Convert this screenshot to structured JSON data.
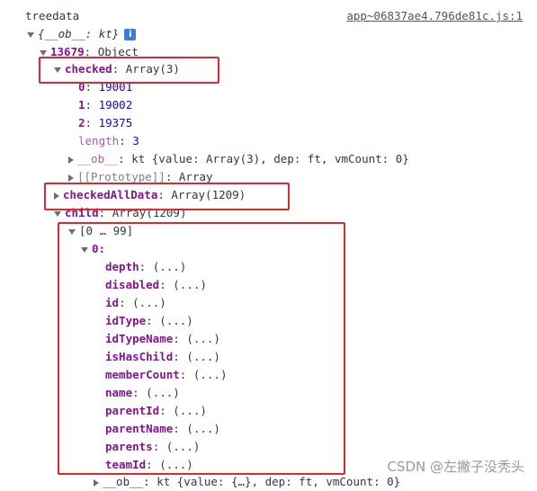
{
  "root_label": "treedata",
  "source_link": "app~06837ae4.796de81c.js:1",
  "root_obj": "{__ob__: kt}",
  "obj_key": "13679",
  "obj_val": ": Object",
  "checked": {
    "key": "checked",
    "val": ": Array(3)"
  },
  "checked_items": [
    {
      "idx": "0",
      "val": "19001"
    },
    {
      "idx": "1",
      "val": "19002"
    },
    {
      "idx": "2",
      "val": "19375"
    }
  ],
  "length_key": "length",
  "length_val": "3",
  "ob_key": "__ob__",
  "ob_val": ": kt {value: Array(3), dep: ft, vmCount: 0}",
  "proto_key": "[[Prototype]]",
  "proto_val": ": Array",
  "checked_all": {
    "key": "checkedAllData",
    "val": ": Array(1209)"
  },
  "child": {
    "key": "child",
    "val": ": Array(1209)"
  },
  "range_label": "[0 … 99]",
  "item0_key": "0:",
  "fields": [
    {
      "key": "depth",
      "val": ": (...)"
    },
    {
      "key": "disabled",
      "val": ": (...)"
    },
    {
      "key": "id",
      "val": ": (...)"
    },
    {
      "key": "idType",
      "val": ": (...)"
    },
    {
      "key": "idTypeName",
      "val": ": (...)"
    },
    {
      "key": "isHasChild",
      "val": ": (...)"
    },
    {
      "key": "memberCount",
      "val": ": (...)"
    },
    {
      "key": "name",
      "val": ": (...)"
    },
    {
      "key": "parentId",
      "val": ": (...)"
    },
    {
      "key": "parentName",
      "val": ": (...)"
    },
    {
      "key": "parents",
      "val": ": (...)"
    },
    {
      "key": "teamId",
      "val": ": (...)"
    }
  ],
  "bottom_ob": "__ob__: kt {value: {…}, dep: ft, vmCount: 0}",
  "watermark": "CSDN @左撇子没秃头",
  "colors": {
    "highlight": "#e0282e",
    "key": "#881391",
    "number": "#1c00cf"
  }
}
